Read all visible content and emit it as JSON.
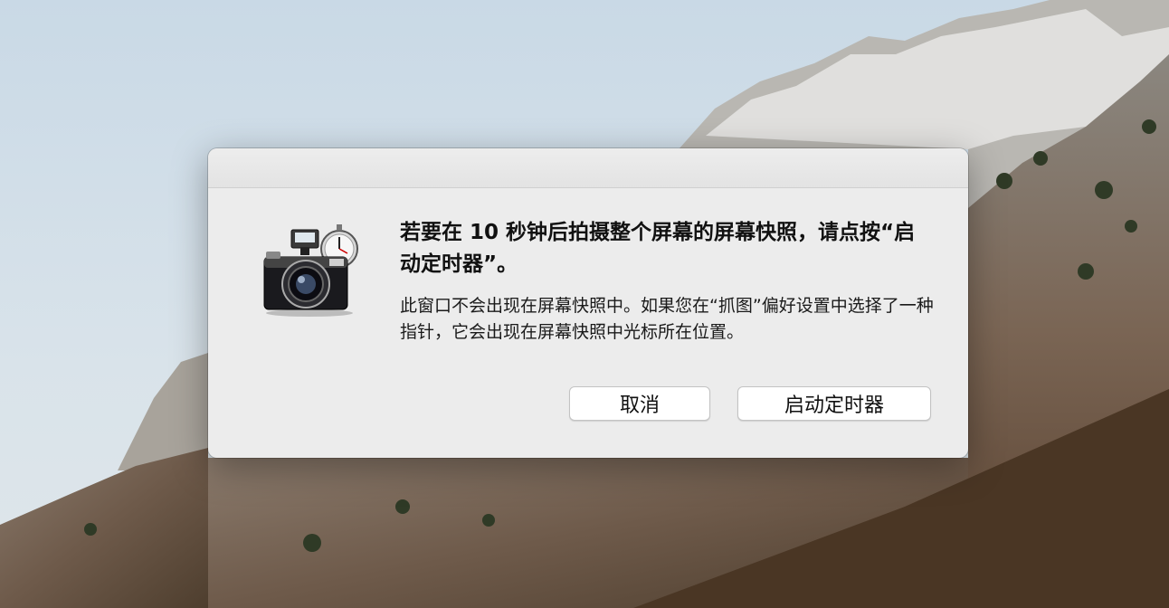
{
  "dialog": {
    "heading": "若要在 10 秒钟后拍摄整个屏幕的屏幕快照，请点按“启动定时器”。",
    "body": "此窗口不会出现在屏幕快照中。如果您在“抓图”偏好设置中选择了一种指针，它会出现在屏幕快照中光标所在位置。",
    "icon": "camera-with-stopwatch-icon",
    "cancel_label": "取消",
    "start_label": "启动定时器"
  }
}
